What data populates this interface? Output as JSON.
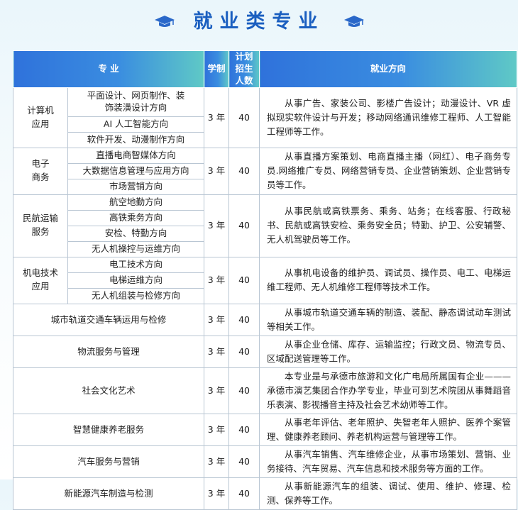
{
  "title": "就业类专业",
  "icons": {
    "left": "graduation-cap-icon",
    "right": "graduation-cap-icon"
  },
  "colors": {
    "title": "#1b5fc0",
    "header_start": "#2f72db",
    "header_end": "#5fc9c6"
  },
  "table": {
    "headers": {
      "major": "专  业",
      "years": "学制",
      "plan": "计划招生人数",
      "direction": "就业方向"
    },
    "rows": [
      {
        "category": "计算机应用",
        "subs": [
          "平面设计、网页制作、装饰装潢设计方向",
          "AI 人工智能方向",
          "软件开发、动漫制作方向"
        ],
        "years": "3 年",
        "plan": "40",
        "direction": "从事广告、家装公司、影楼广告设计；动漫设计、VR 虚拟现实软件设计与开发；移动网络通讯维修工程师、人工智能工程师等工作。"
      },
      {
        "category": "电子商务",
        "subs": [
          "直播电商智媒体方向",
          "大数据信息管理与应用方向",
          "市场营销方向"
        ],
        "years": "3 年",
        "plan": "40",
        "direction": "从事直播方案策划、电商直播主播（网红）、电子商务专员.网络推广专员、网络营销专员、企业营销策划、企业营销专员等工作。"
      },
      {
        "category": "民航运输服务",
        "subs": [
          "航空地勤方向",
          "高铁乘务方向",
          "安检、特勤方向",
          "无人机操控与运维方向"
        ],
        "years": "3 年",
        "plan": "40",
        "direction": "从事民航或高铁票务、乘务、站务；在线客服、行政秘书、民航或高铁安检、乘务安全员；特勤、护卫、公安辅警、无人机驾驶员等工作。"
      },
      {
        "category": "机电技术应用",
        "subs": [
          "电工技术方向",
          "电梯运维方向",
          "无人机组装与检修方向"
        ],
        "years": "3 年",
        "plan": "40",
        "direction": "从事机电设备的维护员、调试员、操作员、电工、电梯运维工程师、无人机维修工程师等技术工作。"
      },
      {
        "major": "城市轨道交通车辆运用与检修",
        "years": "3 年",
        "plan": "40",
        "direction": "从事城市轨道交通车辆的制造、装配、静态调试动车测试等相关工作。"
      },
      {
        "major": "物流服务与管理",
        "years": "3 年",
        "plan": "40",
        "direction": "从事企业仓储、库存、运输监控；行政文员、物流专员、区域配送管理等工作。"
      },
      {
        "major": "社会文化艺术",
        "years": "3 年",
        "plan": "40",
        "direction": "本专业是与承德市旅游和文化广电局所属国有企业———承德市演艺集团合作办学专业，毕业可到艺术院团从事舞蹈音乐表演、影视播音主持及社会艺术幼师等工作。"
      },
      {
        "major": "智慧健康养老服务",
        "years": "3 年",
        "plan": "40",
        "direction": "从事老年评估、老年照护、失智老年人照护、医养个案管理、健康养老顾问、养老机构运营与管理等工作。"
      },
      {
        "major": "汽车服务与营销",
        "years": "3 年",
        "plan": "40",
        "direction": "从事汽车销售、汽车维修企业，从事市场策划、营销、业务接待、汽车贸易、汽车信息和技术服务等方面的工作。"
      },
      {
        "major": "新能源汽车制造与检测",
        "years": "3 年",
        "plan": "40",
        "direction": "从事新能源汽车的组装、调试、使用、维护、修理、检测、保养等工作。"
      }
    ]
  }
}
